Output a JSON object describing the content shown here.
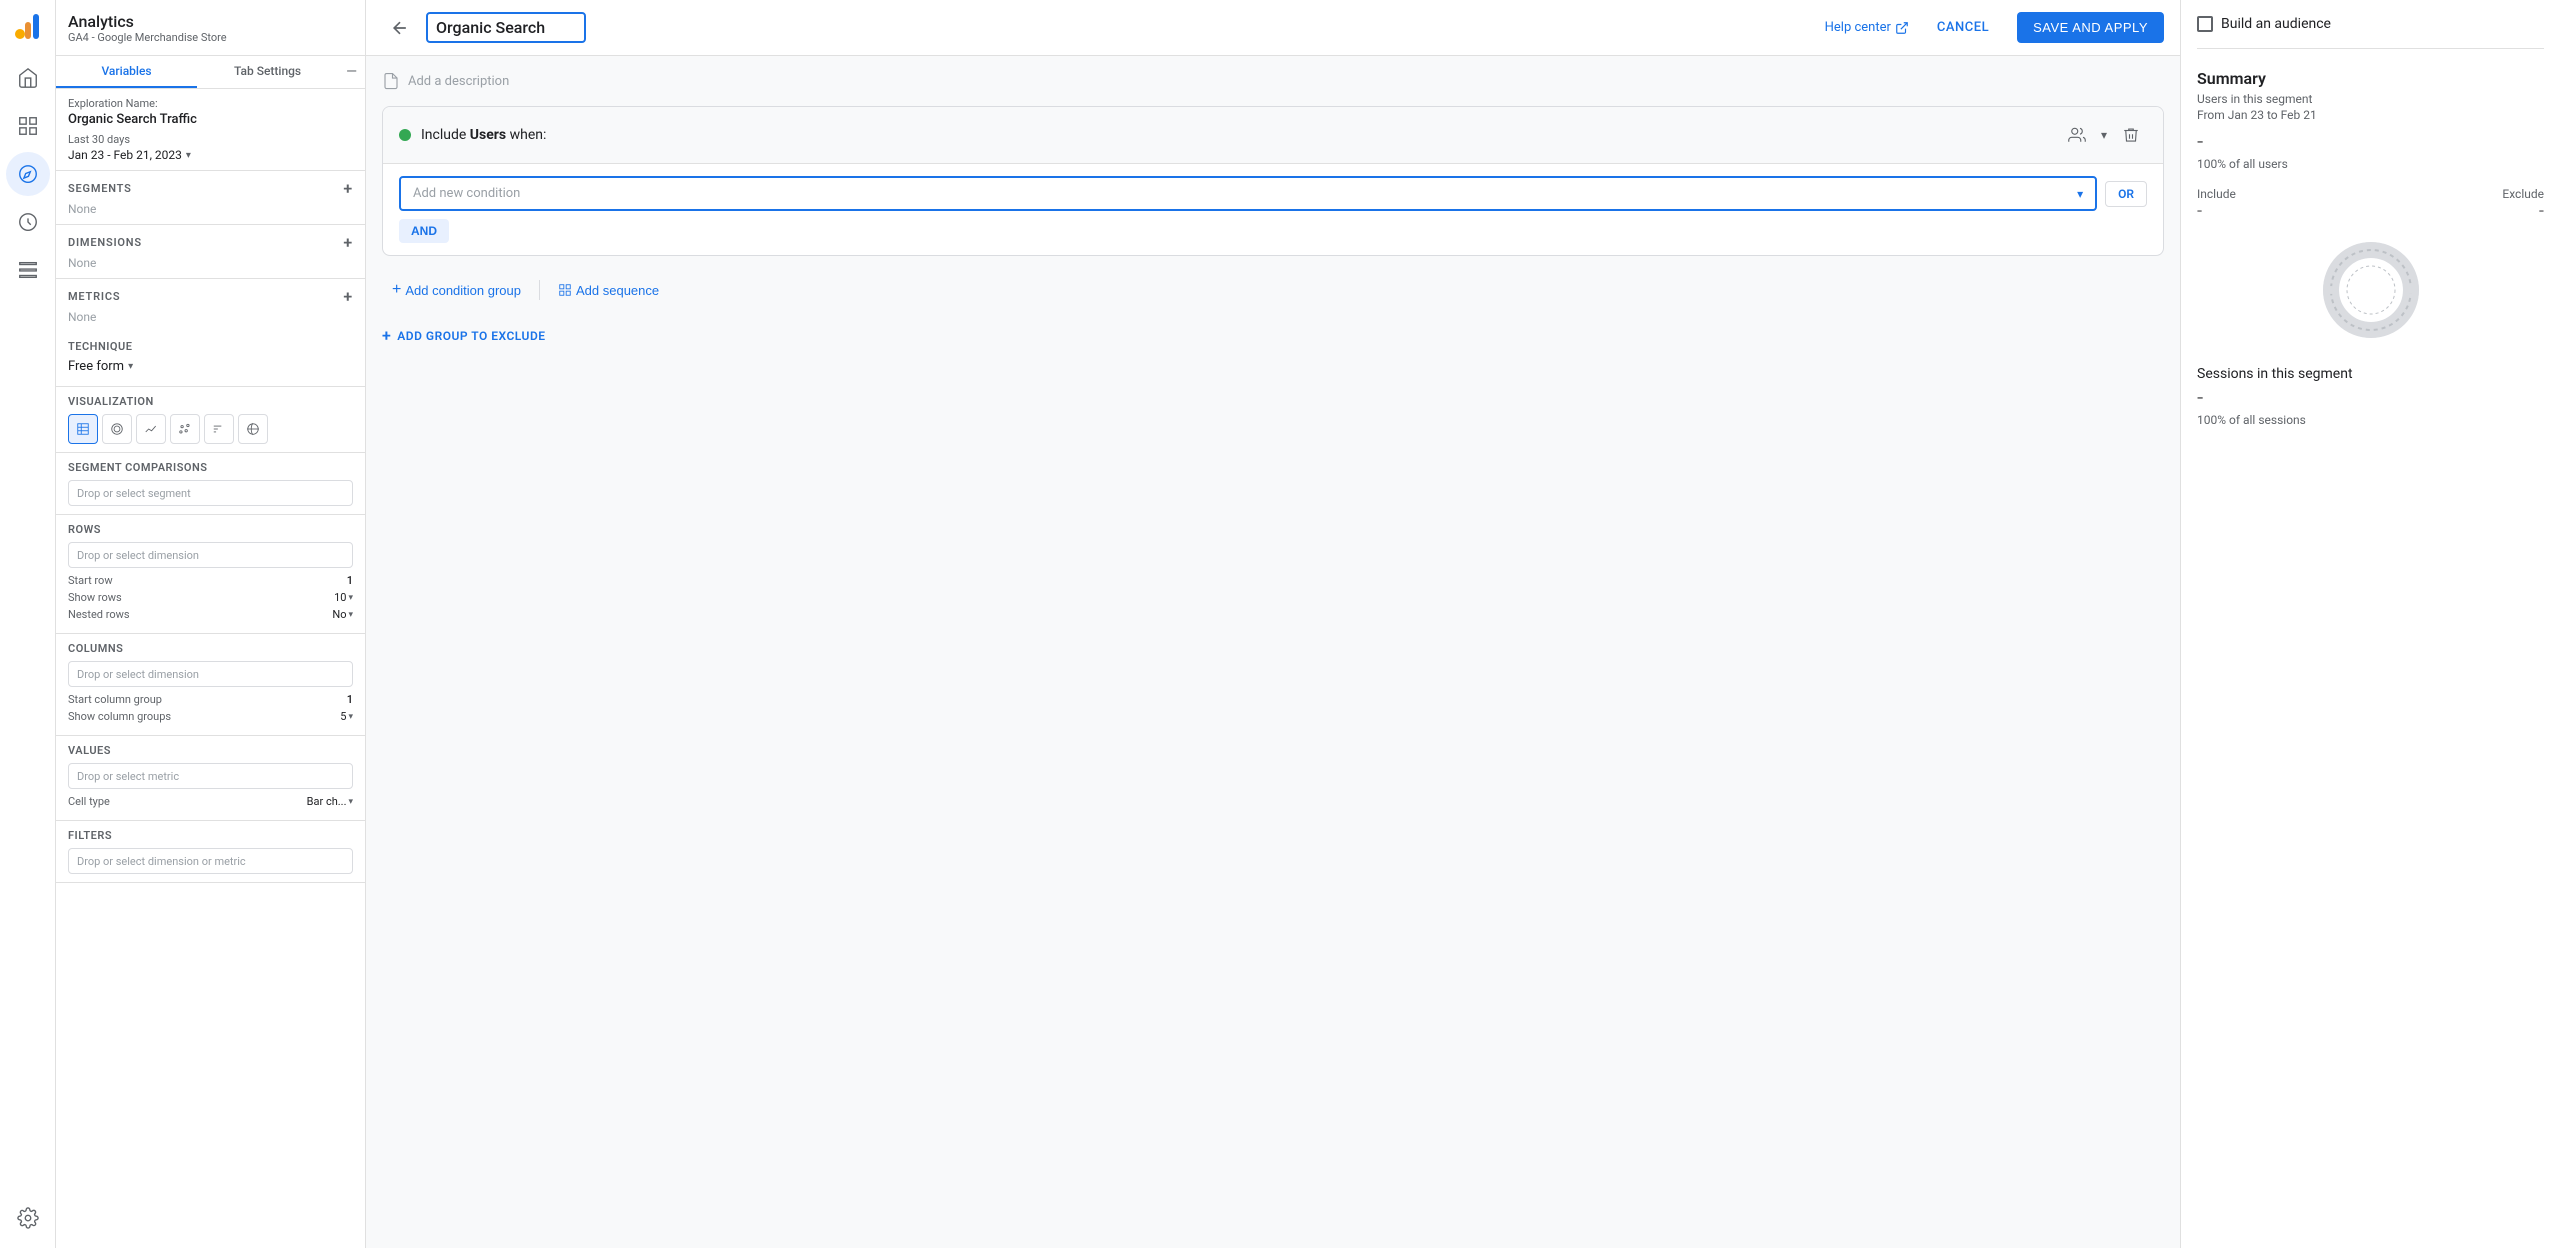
{
  "app": {
    "title": "Analytics",
    "subtitle": "GA4 - Google Merchandise Store",
    "account": "GA4 - Google Merchandise ..."
  },
  "leftNav": {
    "icons": [
      {
        "name": "home-icon",
        "symbol": "⌂",
        "active": false
      },
      {
        "name": "bar-chart-icon",
        "symbol": "📊",
        "active": false
      },
      {
        "name": "explore-icon",
        "symbol": "🔵",
        "active": true
      },
      {
        "name": "people-icon",
        "symbol": "👤",
        "active": false
      },
      {
        "name": "list-icon",
        "symbol": "☰",
        "active": false
      }
    ],
    "bottomIcons": [
      {
        "name": "settings-icon",
        "symbol": "⚙"
      }
    ]
  },
  "sidebar": {
    "tabs": [
      {
        "label": "Variables",
        "active": true
      },
      {
        "label": "Tab Settings",
        "active": false
      }
    ],
    "explorationName": {
      "label": "Exploration Name:",
      "value": "Organic Search Traffic"
    },
    "dateRange": {
      "label": "Last 30 days",
      "value": "Jan 23 - Feb 21, 2023"
    },
    "segments": {
      "title": "SEGMENTS",
      "value": "None"
    },
    "dimensions": {
      "title": "DIMENSIONS",
      "value": "None"
    },
    "metrics": {
      "title": "METRICS",
      "value": "None"
    }
  },
  "tabSettings": {
    "technique": {
      "label": "TECHNIQUE",
      "value": "Free form"
    },
    "visualization": {
      "label": "VISUALIZATION"
    },
    "segmentComparisons": {
      "label": "SEGMENT COMPARISONS",
      "placeholder": "Drop or select segment"
    },
    "rows": {
      "label": "ROWS",
      "placeholder": "Drop or select dimension",
      "startRow": {
        "label": "Start row",
        "value": "1"
      },
      "showRows": {
        "label": "Show rows",
        "value": "10"
      },
      "nestedRows": {
        "label": "Nested rows",
        "value": "No"
      }
    },
    "columns": {
      "label": "COLUMNS",
      "placeholder": "Drop or select dimension",
      "startColumnGroup": {
        "label": "Start column group",
        "value": "1"
      },
      "showColumnGroups": {
        "label": "Show column groups",
        "value": "5"
      }
    },
    "values": {
      "label": "VALUES",
      "placeholder": "Drop or select metric",
      "cellType": {
        "label": "Cell type",
        "value": "Bar ch..."
      }
    },
    "filters": {
      "label": "FILTERS",
      "placeholder": "Drop or select dimension or metric"
    }
  },
  "segmentEditor": {
    "title": "Organic Search",
    "description": "Add a description",
    "helpCenter": "Help center",
    "cancelLabel": "CANCEL",
    "saveLabel": "SAVE AND APPLY",
    "includeBlock": {
      "text": "Include",
      "boldText": "Users",
      "afterText": "when:",
      "addNewCondition": "Add new condition",
      "orLabel": "OR",
      "andLabel": "AND"
    },
    "actions": {
      "addConditionGroup": "Add condition group",
      "addSequence": "Add sequence"
    },
    "addExclude": "ADD GROUP TO EXCLUDE"
  },
  "summary": {
    "buildAudience": "Build an audience",
    "title": "Summary",
    "usersInSegment": "Users in this segment",
    "dateRange": "From Jan 23 to Feb 21",
    "usersDash": "-",
    "usersPercent": "100% of all users",
    "includeLabel": "Include",
    "excludeLabel": "Exclude",
    "includeDash": "-",
    "excludeDash": "-",
    "sessionsTitle": "Sessions in this segment",
    "sessionsDash": "-",
    "sessionsPercent": "100% of all sessions"
  }
}
